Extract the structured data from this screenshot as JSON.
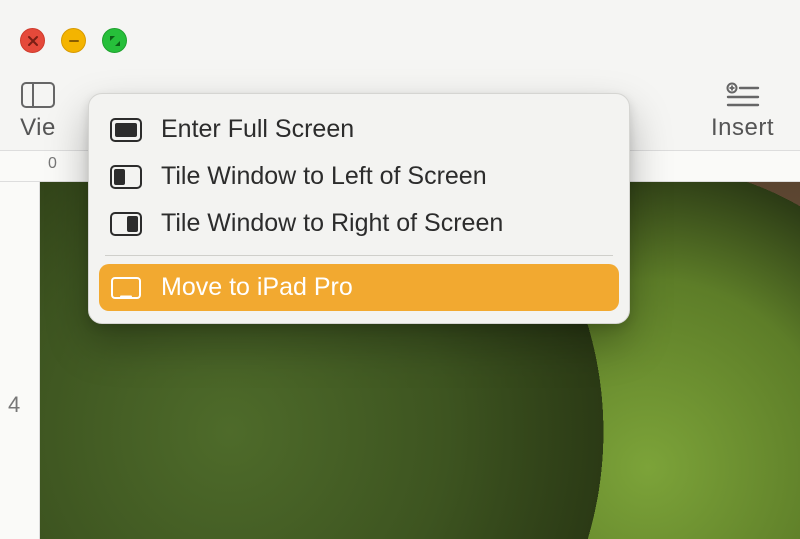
{
  "traffic_lights": {
    "close_tip": "Close",
    "minimize_tip": "Minimize",
    "zoom_tip": "Zoom"
  },
  "toolbar": {
    "left_label": "Vie",
    "right_label": "Insert"
  },
  "ruler": {
    "h0": "0",
    "v4": "4"
  },
  "fullscreen_menu": {
    "item0": "Enter Full Screen",
    "item1": "Tile Window to Left of Screen",
    "item2": "Tile Window to Right of Screen",
    "item3": "Move to iPad Pro"
  },
  "colors": {
    "highlight": "#f2a930"
  }
}
